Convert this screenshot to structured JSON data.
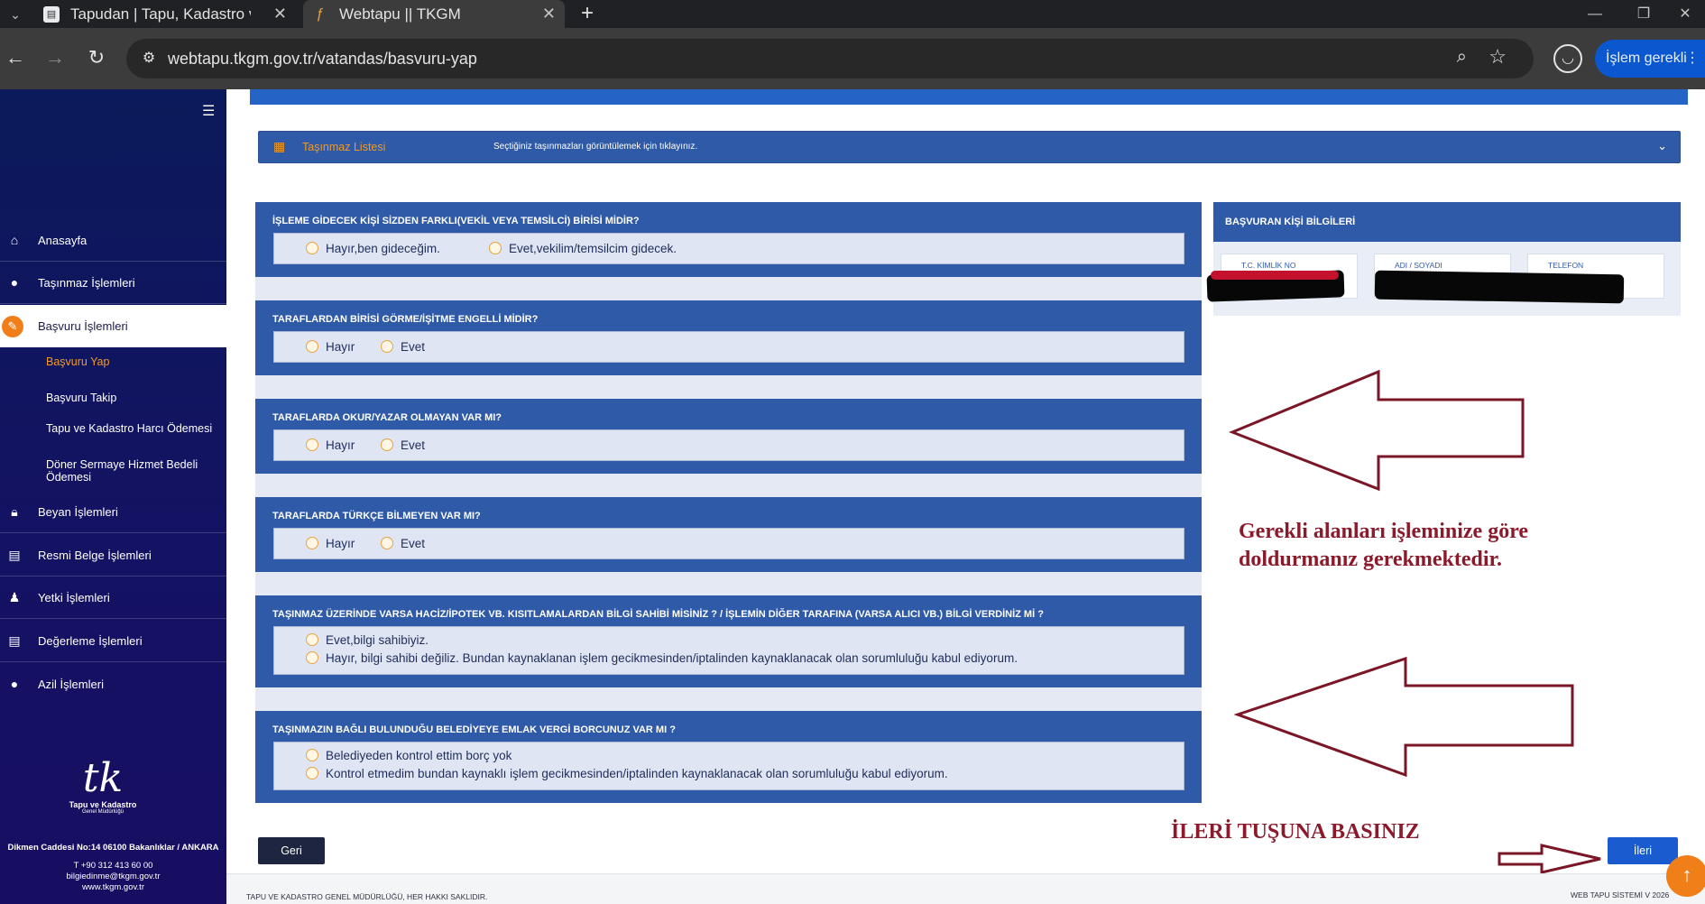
{
  "browser": {
    "tabs": [
      {
        "title": "Tapudan | Tapu, Kadastro ve Ga",
        "favicon": "document-icon",
        "active": false
      },
      {
        "title": "Webtapu || TKGM",
        "favicon": "tkgm-icon",
        "active": true
      }
    ],
    "new_tab": "+",
    "url": "webtapu.tkgm.gov.tr/vatandas/basvuru-yap",
    "action_label": "İşlem gerekli",
    "window_controls": {
      "minimize": "—",
      "maximize": "❐",
      "close": "✕"
    }
  },
  "sidebar": {
    "items": [
      {
        "label": "Anasayfa",
        "icon": "home-icon"
      },
      {
        "label": "Taşınmaz İşlemleri",
        "icon": "pin-icon"
      },
      {
        "label": "Başvuru İşlemleri",
        "icon": "pencil-icon",
        "active": true
      },
      {
        "label": "Beyan İşlemleri",
        "icon": "lock-icon"
      },
      {
        "label": "Resmi Belge İşlemleri",
        "icon": "document-icon"
      },
      {
        "label": "Yetki İşlemleri",
        "icon": "user-icon"
      },
      {
        "label": "Değerleme İşlemleri",
        "icon": "document-icon"
      },
      {
        "label": "Azil İşlemleri",
        "icon": "pin-icon"
      }
    ],
    "subitems": [
      {
        "label": "Başvuru Yap",
        "current": true
      },
      {
        "label": "Başvuru Takip"
      },
      {
        "label": "Tapu ve Kadastro Harcı Ödemesi"
      },
      {
        "label": "Döner Sermaye Hizmet Bedeli Ödemesi"
      }
    ],
    "logo": {
      "mark": "tk",
      "name": "Tapu ve Kadastro",
      "subname": "Genel Müdürlüğü"
    },
    "address": "Dikmen Caddesi No:14 06100 Bakanlıklar / ANKARA",
    "phone": "T +90 312 413 60 00",
    "email": "bilgiedinme@tkgm.gov.tr",
    "web": "www.tkgm.gov.tr"
  },
  "tasinmaz": {
    "title": "Taşınmaz Listesi",
    "hint": "Seçtiğiniz taşınmazları görüntülemek için tıklayınız."
  },
  "questions": [
    {
      "text": "İŞLEME GİDECEK KİŞİ SİZDEN FARKLI(VEKİL VEYA TEMSİLCİ) BİRİSİ MİDİR?",
      "options": [
        "Hayır,ben gideceğim.",
        "Evet,vekilim/temsilcim gidecek."
      ]
    },
    {
      "text": "TARAFLARDAN BİRİSİ GÖRME/İŞİTME ENGELLİ MİDİR?",
      "options": [
        "Hayır",
        "Evet"
      ]
    },
    {
      "text": "TARAFLARDA OKUR/YAZAR OLMAYAN VAR MI?",
      "options": [
        "Hayır",
        "Evet"
      ]
    },
    {
      "text": "TARAFLARDA TÜRKÇE BİLMEYEN VAR MI?",
      "options": [
        "Hayır",
        "Evet"
      ]
    },
    {
      "text": "TAŞINMAZ ÜZERİNDE VARSA HACİZ/İPOTEK VB. KISITLAMALARDAN BİLGİ SAHİBİ MİSİNİZ ? / İŞLEMİN DİĞER TARAFINA (VARSA ALICI VB.) BİLGİ VERDİNİZ Mİ ?",
      "options": [
        "Evet,bilgi sahibiyiz.",
        "Hayır, bilgi sahibi değiliz. Bundan kaynaklanan işlem gecikmesinden/iptalinden kaynaklanacak olan sorumluluğu kabul ediyorum."
      ]
    },
    {
      "text": "TAŞINMAZIN BAĞLI BULUNDUĞU BELEDİYEYE EMLAK VERGİ BORCUNUZ VAR MI ?",
      "options": [
        "Belediyeden kontrol ettim borç yok",
        "Kontrol etmedim bundan kaynaklı işlem gecikmesinden/iptalinden kaynaklanacak olan sorumluluğu kabul ediyorum."
      ]
    }
  ],
  "applicant": {
    "title": "BAŞVURAN KİŞİ BİLGİLERİ",
    "fields": [
      "T.C. KİMLİK NO",
      "ADI / SOYADI",
      "TELEFON"
    ]
  },
  "annotations": {
    "instruction_line1": "Gerekli alanları işleminize göre",
    "instruction_line2": "doldurmanız gerekmektedir.",
    "next_hint": "İLERİ TUŞUNA BASINIZ",
    "color": "#8b1a2b"
  },
  "buttons": {
    "back": "Geri",
    "next": "İleri",
    "scroll_top": "↑"
  },
  "footer": {
    "left": "TAPU VE KADASTRO GENEL MÜDÜRLÜĞÜ, HER HAKKI SAKLIDIR.",
    "right": "WEB TAPU SİSTEMİ V 2026"
  },
  "colors": {
    "panel": "#2f5aa8",
    "sidebar": "#141263",
    "accent": "#f07f1a",
    "primary": "#1a5cd0"
  }
}
